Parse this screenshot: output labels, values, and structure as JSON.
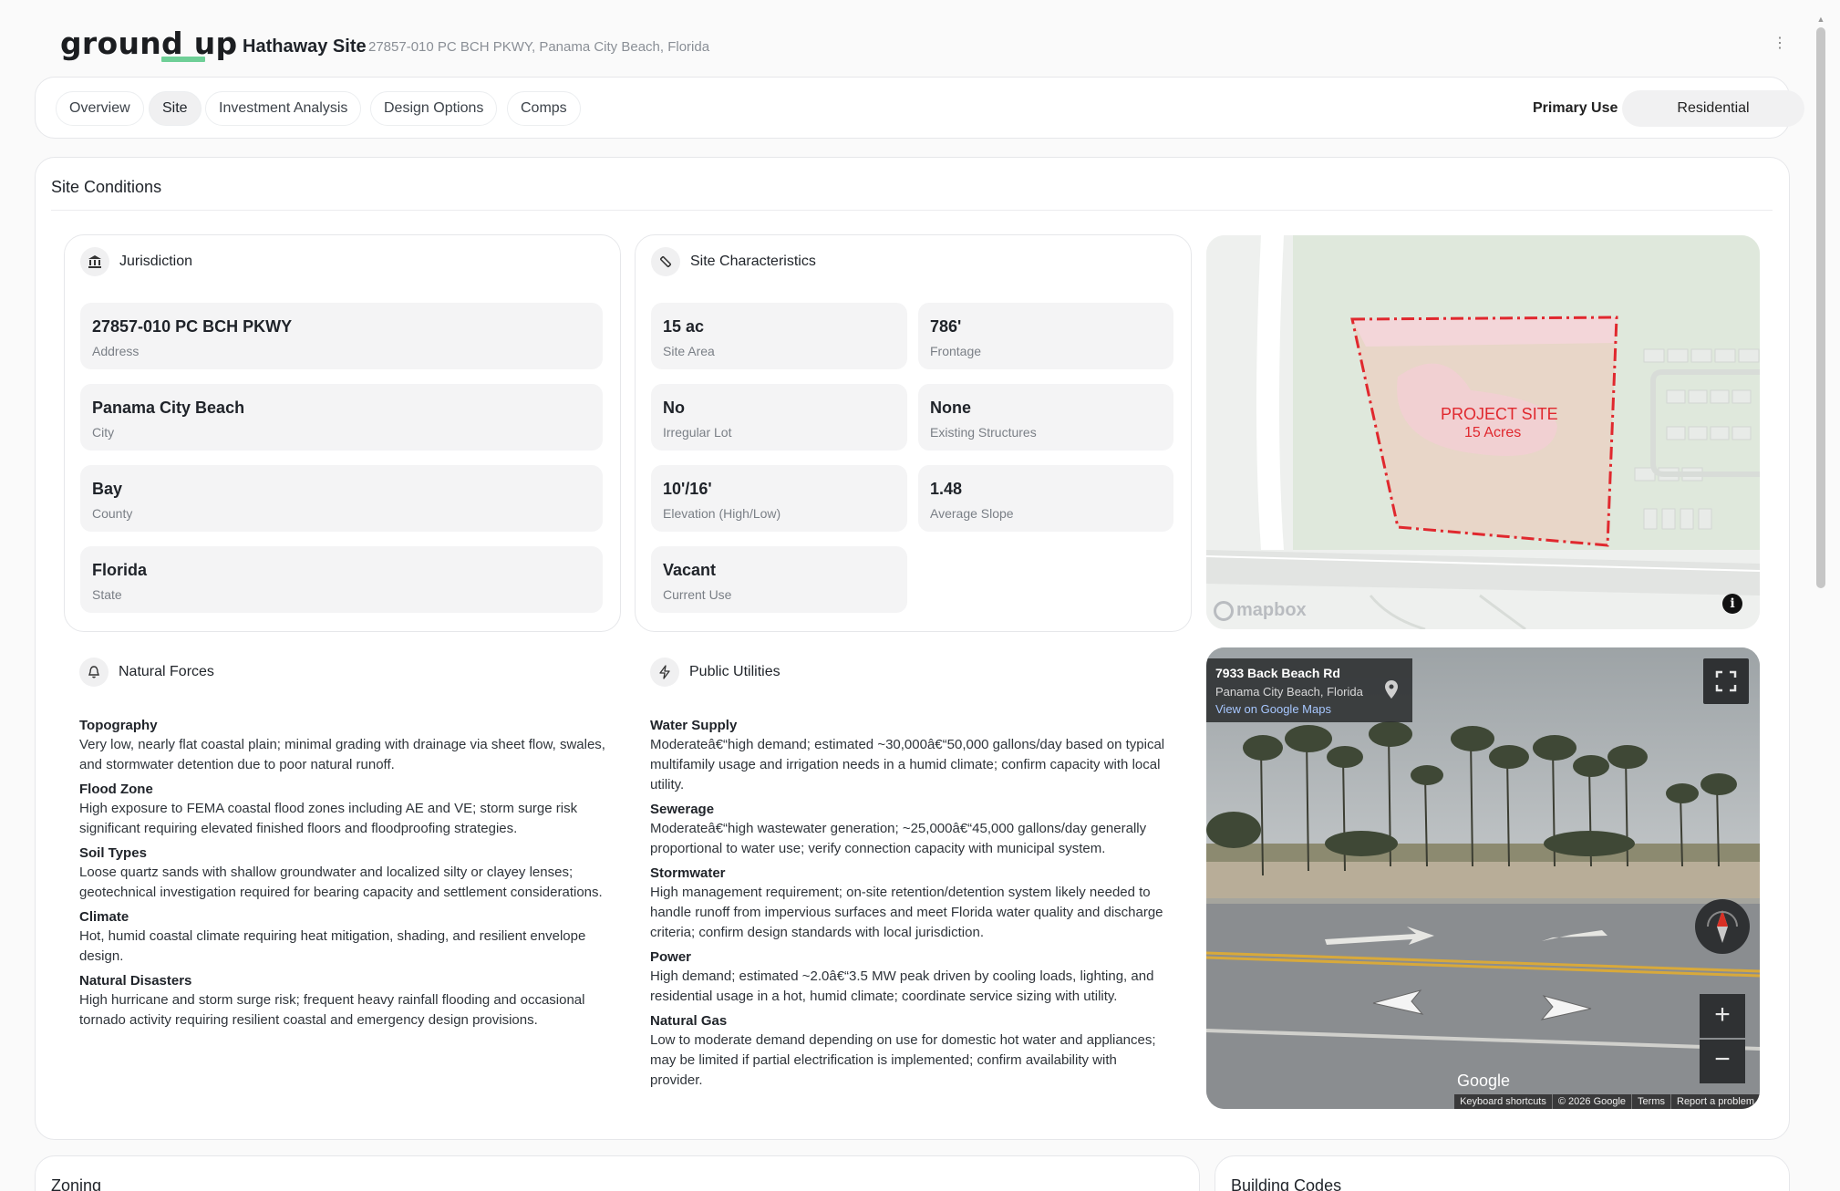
{
  "header": {
    "logo": "ground up",
    "site_name": "Hathaway Site",
    "site_address": "27857-010 PC BCH PKWY, Panama City Beach, Florida",
    "menu_icon": "kebab-icon"
  },
  "nav": {
    "tabs": [
      {
        "label": "Overview",
        "active": false
      },
      {
        "label": "Site",
        "active": true
      },
      {
        "label": "Investment Analysis",
        "active": false
      },
      {
        "label": "Design Options",
        "active": false
      },
      {
        "label": "Comps",
        "active": false
      }
    ],
    "primary_use_label": "Primary Use",
    "primary_use_value": "Residential"
  },
  "site_conditions": {
    "title": "Site Conditions",
    "jurisdiction": {
      "label": "Jurisdiction",
      "icon": "building-icon",
      "fields": [
        {
          "value": "27857-010 PC BCH PKWY",
          "label": "Address"
        },
        {
          "value": "Panama City Beach",
          "label": "City"
        },
        {
          "value": "Bay",
          "label": "County"
        },
        {
          "value": "Florida",
          "label": "State"
        }
      ]
    },
    "characteristics": {
      "label": "Site Characteristics",
      "icon": "ruler-icon",
      "fields": [
        {
          "value": "15 ac",
          "label": "Site Area"
        },
        {
          "value": "786'",
          "label": "Frontage"
        },
        {
          "value": "No",
          "label": "Irregular Lot"
        },
        {
          "value": "None",
          "label": "Existing Structures"
        },
        {
          "value": "10'/16'",
          "label": "Elevation (High/Low)"
        },
        {
          "value": "1.48",
          "label": "Average Slope"
        },
        {
          "value": "Vacant",
          "label": "Current Use"
        }
      ]
    },
    "natural_forces": {
      "label": "Natural Forces",
      "icon": "bell-icon",
      "items": [
        {
          "title": "Topography",
          "text": "Very low, nearly flat coastal plain; minimal grading with drainage via sheet flow, swales, and stormwater detention due to poor natural runoff."
        },
        {
          "title": "Flood Zone",
          "text": "High exposure to FEMA coastal flood zones including AE and VE; storm surge risk significant requiring elevated finished floors and floodproofing strategies."
        },
        {
          "title": "Soil Types",
          "text": "Loose quartz sands with shallow groundwater and localized silty or clayey lenses; geotechnical investigation required for bearing capacity and settlement considerations."
        },
        {
          "title": "Climate",
          "text": "Hot, humid coastal climate requiring heat mitigation, shading, and resilient envelope design."
        },
        {
          "title": "Natural Disasters",
          "text": "High hurricane and storm surge risk; frequent heavy rainfall flooding and occasional tornado activity requiring resilient coastal and emergency design provisions."
        }
      ]
    },
    "public_utilities": {
      "label": "Public Utilities",
      "icon": "lightning-icon",
      "items": [
        {
          "title": "Water Supply",
          "text": "Moderateâ€“high demand; estimated ~30,000â€“50,000 gallons/day based on typical multifamily usage and irrigation needs in a humid climate; confirm capacity with local utility."
        },
        {
          "title": "Sewerage",
          "text": "Moderateâ€“high wastewater generation; ~25,000â€“45,000 gallons/day generally proportional to water use; verify connection capacity with municipal system."
        },
        {
          "title": "Stormwater",
          "text": "High management requirement; on-site retention/detention system likely needed to handle runoff from impervious surfaces and meet Florida water quality and discharge criteria; confirm design standards with local jurisdiction."
        },
        {
          "title": "Power",
          "text": "High demand; estimated ~2.0â€“3.5 MW peak driven by cooling loads, lighting, and residential usage in a hot, humid climate; coordinate service sizing with utility."
        },
        {
          "title": "Natural Gas",
          "text": "Low to moderate demand depending on use for domestic hot water and appliances; may be limited if partial electrification is implemented; confirm availability with provider."
        }
      ]
    },
    "map": {
      "site_label": "PROJECT SITE",
      "site_sub": "15 Acres",
      "attribution": "mapbox",
      "info_icon": "info-icon",
      "boundary_color": "#e0282e"
    },
    "street_view": {
      "place": "7933 Back Beach Rd",
      "locality": "Panama City Beach, Florida",
      "link": "View on Google Maps",
      "brand": "Google",
      "footer_links": [
        "Keyboard shortcuts",
        "© 2026 Google",
        "Terms",
        "Report a problem"
      ]
    }
  },
  "zoning": {
    "title": "Zoning"
  },
  "building_codes": {
    "title": "Building Codes"
  }
}
